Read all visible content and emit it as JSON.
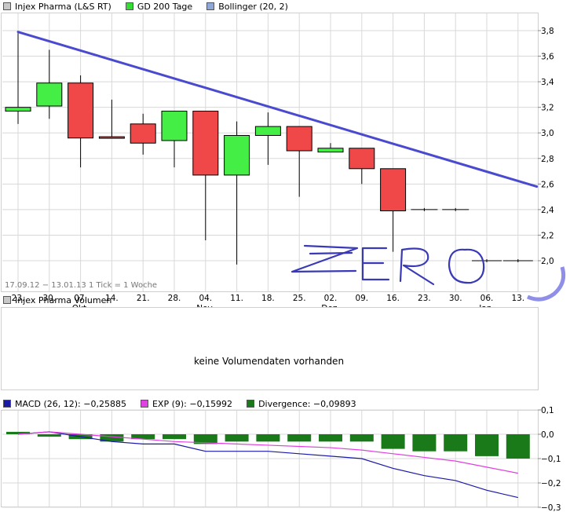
{
  "price_legend": [
    {
      "label": "Injex Pharma (L&S RT)",
      "color": "#c8c8c8"
    },
    {
      "label": "GD 200 Tage",
      "color": "#33dd33"
    },
    {
      "label": "Bollinger (20, 2)",
      "color": "#8fa8d8"
    }
  ],
  "volume_legend": {
    "label": "Injex Pharma Volumen",
    "color": "#c8c8c8"
  },
  "volume_message": "keine Volumendaten vorhanden",
  "macd_legend": [
    {
      "label": "MACD (26, 12): −0,25885",
      "color": "#1a1aa8"
    },
    {
      "label": "EXP (9): −0,15992",
      "color": "#e040e0"
    },
    {
      "label": "Divergence: −0,09893",
      "color": "#1a7a1a"
    }
  ],
  "range_text": "17.09.12 − 13.01.13   1 Tick = 1 Woche",
  "annotation_text": "ZERO",
  "chart_data": [
    {
      "type": "candlestick",
      "title": "Injex Pharma (L&S RT)",
      "x_ticks": [
        "23.",
        "30.",
        "07.",
        "14.",
        "21.",
        "28.",
        "04.",
        "11.",
        "18.",
        "25.",
        "02.",
        "09.",
        "16.",
        "23.",
        "30.",
        "06.",
        "13."
      ],
      "x_month_labels": [
        {
          "tick_index": 2,
          "label": "Okt."
        },
        {
          "tick_index": 6,
          "label": "Nov."
        },
        {
          "tick_index": 10,
          "label": "Dez."
        },
        {
          "tick_index": 15,
          "label": "Jan."
        }
      ],
      "y_ticks": [
        "3,8",
        "3,6",
        "3,4",
        "3,2",
        "3,0",
        "2,8",
        "2,6",
        "2,4",
        "2,2",
        "2,0"
      ],
      "ylim": [
        1.9,
        3.92
      ],
      "grid": true,
      "candles": [
        {
          "open": 3.17,
          "close": 3.2,
          "high": 3.78,
          "low": 3.07,
          "direction": "up"
        },
        {
          "open": 3.21,
          "close": 3.39,
          "high": 3.65,
          "low": 3.11,
          "direction": "up"
        },
        {
          "open": 3.39,
          "close": 2.96,
          "high": 3.45,
          "low": 2.73,
          "direction": "down"
        },
        {
          "open": 2.97,
          "close": 2.96,
          "high": 3.26,
          "low": 2.96,
          "direction": "down"
        },
        {
          "open": 3.07,
          "close": 2.92,
          "high": 3.15,
          "low": 2.83,
          "direction": "down"
        },
        {
          "open": 2.94,
          "close": 3.17,
          "high": 3.17,
          "low": 2.73,
          "direction": "up"
        },
        {
          "open": 3.17,
          "close": 2.67,
          "high": 3.17,
          "low": 2.16,
          "direction": "down"
        },
        {
          "open": 2.67,
          "close": 2.98,
          "high": 3.09,
          "low": 1.97,
          "direction": "up"
        },
        {
          "open": 2.98,
          "close": 3.05,
          "high": 3.16,
          "low": 2.75,
          "direction": "up"
        },
        {
          "open": 3.05,
          "close": 2.86,
          "high": 3.05,
          "low": 2.5,
          "direction": "down"
        },
        {
          "open": 2.85,
          "close": 2.88,
          "high": 2.92,
          "low": 2.85,
          "direction": "up"
        },
        {
          "open": 2.88,
          "close": 2.72,
          "high": 2.88,
          "low": 2.6,
          "direction": "down"
        },
        {
          "open": 2.72,
          "close": 2.39,
          "high": 2.72,
          "low": 2.07,
          "direction": "down"
        },
        {
          "open": 2.4,
          "close": 2.4,
          "high": 2.4,
          "low": 2.4,
          "direction": "flat"
        },
        {
          "open": 2.4,
          "close": 2.4,
          "high": 2.4,
          "low": 2.4,
          "direction": "flat"
        },
        {
          "open": 2.0,
          "close": 2.0,
          "high": 2.0,
          "low": 2.0,
          "direction": "flat"
        },
        {
          "open": 2.0,
          "close": 2.0,
          "high": 2.0,
          "low": 2.0,
          "direction": "flat"
        }
      ],
      "trendline": {
        "from": {
          "tick_index": 0,
          "value": 3.79
        },
        "to": {
          "tick_index": 16.6,
          "value": 2.58
        },
        "color": "#4a4ad0"
      },
      "colors": {
        "up": "#44ee44",
        "down": "#f04848",
        "grid": "#d8d8d8"
      }
    },
    {
      "type": "macd",
      "y_ticks": [
        "0,1",
        "0,0",
        "−0,1",
        "−0,2",
        "−0,3"
      ],
      "y_tick_values": [
        0.1,
        0.0,
        -0.1,
        -0.2,
        -0.3
      ],
      "ylim": [
        -0.31,
        0.11
      ],
      "divergence": [
        0.01,
        -0.01,
        -0.02,
        -0.03,
        -0.02,
        -0.02,
        -0.04,
        -0.03,
        -0.03,
        -0.03,
        -0.03,
        -0.03,
        -0.06,
        -0.07,
        -0.07,
        -0.09,
        -0.1
      ],
      "series": [
        {
          "name": "MACD (26, 12)",
          "color": "#1a1aa8",
          "x": [
            0,
            1,
            2,
            3,
            4,
            5,
            6,
            7,
            8,
            9,
            10,
            11,
            12,
            13,
            14,
            15,
            16
          ],
          "values": [
            0.0,
            0.01,
            -0.01,
            -0.03,
            -0.04,
            -0.04,
            -0.07,
            -0.07,
            -0.07,
            -0.08,
            -0.09,
            -0.1,
            -0.14,
            -0.17,
            -0.19,
            -0.23,
            -0.26
          ]
        },
        {
          "name": "EXP (9)",
          "color": "#e040e0",
          "x": [
            0,
            1,
            2,
            3,
            4,
            5,
            6,
            7,
            8,
            9,
            10,
            11,
            12,
            13,
            14,
            15,
            16
          ],
          "values": [
            0.0,
            0.01,
            0.0,
            -0.01,
            -0.02,
            -0.03,
            -0.035,
            -0.04,
            -0.045,
            -0.05,
            -0.055,
            -0.065,
            -0.08,
            -0.095,
            -0.11,
            -0.135,
            -0.16
          ]
        }
      ],
      "colors": {
        "divergence": "#1a7a1a",
        "grid": "#d8d8d8"
      }
    }
  ]
}
